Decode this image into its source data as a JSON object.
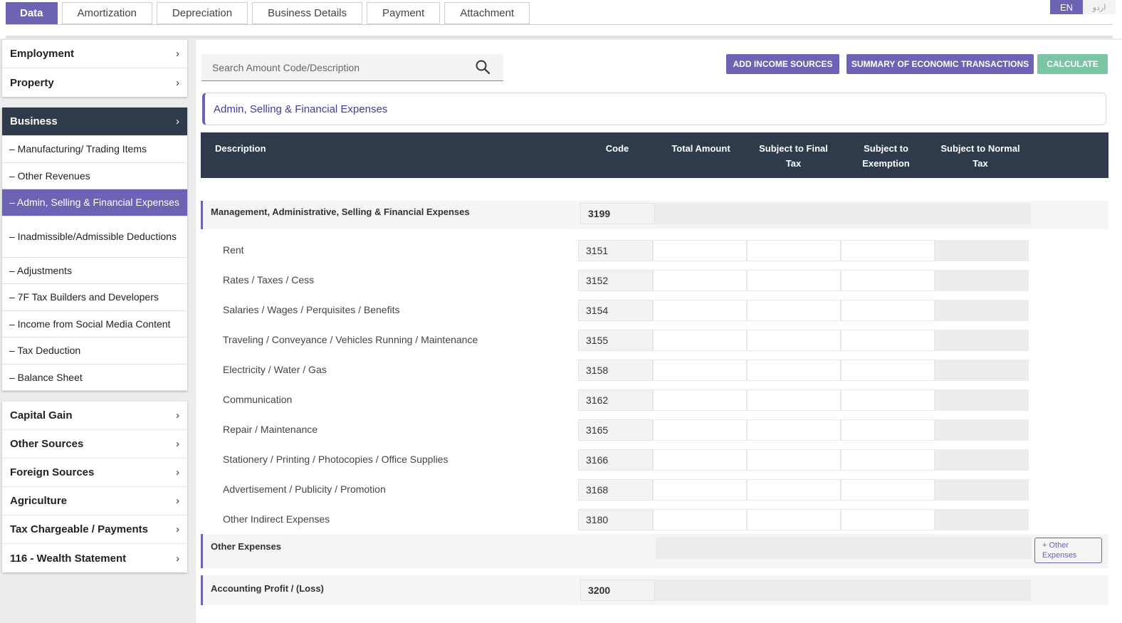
{
  "tabs": [
    {
      "label": "Data",
      "active": true
    },
    {
      "label": "Amortization"
    },
    {
      "label": "Depreciation"
    },
    {
      "label": "Business Details"
    },
    {
      "label": "Payment"
    },
    {
      "label": "Attachment"
    }
  ],
  "lang": {
    "en": "EN",
    "ur": "اردو"
  },
  "sidebar": {
    "group1": [
      "Employment",
      "Property"
    ],
    "business": {
      "title": "Business",
      "items": [
        "– Manufacturing/ Trading Items",
        "– Other Revenues",
        "– Admin, Selling & Financial Expenses",
        "– Inadmissible/Admissible Deductions",
        "– Adjustments",
        "– 7F Tax Builders and Developers",
        "– Income from Social Media Content",
        "– Tax Deduction",
        "– Balance Sheet"
      ],
      "active_index": 2
    },
    "group3": [
      "Capital Gain",
      "Other Sources",
      "Foreign Sources",
      "Agriculture",
      "Tax Chargeable / Payments",
      "116 - Wealth Statement"
    ]
  },
  "search": {
    "placeholder": "Search Amount Code/Description"
  },
  "buttons": {
    "add_income": "ADD INCOME SOURCES",
    "summary": "SUMMARY OF ECONOMIC TRANSACTIONS",
    "calculate": "CALCULATE"
  },
  "section_title": "Admin, Selling & Financial Expenses",
  "table": {
    "headers": {
      "description": "Description",
      "code": "Code",
      "total": "Total Amount",
      "final": "Subject to Final Tax",
      "exemption": "Subject to Exemption",
      "normal": "Subject to Normal Tax"
    },
    "group_header": {
      "label": "Management, Administrative, Selling & Financial Expenses",
      "code": "3199"
    },
    "rows": [
      {
        "label": "Rent",
        "code": "3151"
      },
      {
        "label": "Rates / Taxes / Cess",
        "code": "3152"
      },
      {
        "label": "Salaries / Wages / Perquisites / Benefits",
        "code": "3154"
      },
      {
        "label": "Traveling / Conveyance / Vehicles Running / Maintenance",
        "code": "3155"
      },
      {
        "label": "Electricity / Water / Gas",
        "code": "3158"
      },
      {
        "label": "Communication",
        "code": "3162"
      },
      {
        "label": "Repair / Maintenance",
        "code": "3165"
      },
      {
        "label": "Stationery / Printing / Photocopies / Office Supplies",
        "code": "3166"
      },
      {
        "label": "Advertisement / Publicity / Promotion",
        "code": "3168"
      },
      {
        "label": "Other Indirect Expenses",
        "code": "3180"
      }
    ],
    "other_expenses": {
      "label": "Other Expenses",
      "button": "+ Other Expenses"
    },
    "accounting_profit": {
      "label": "Accounting Profit / (Loss)",
      "code": "3200"
    }
  }
}
